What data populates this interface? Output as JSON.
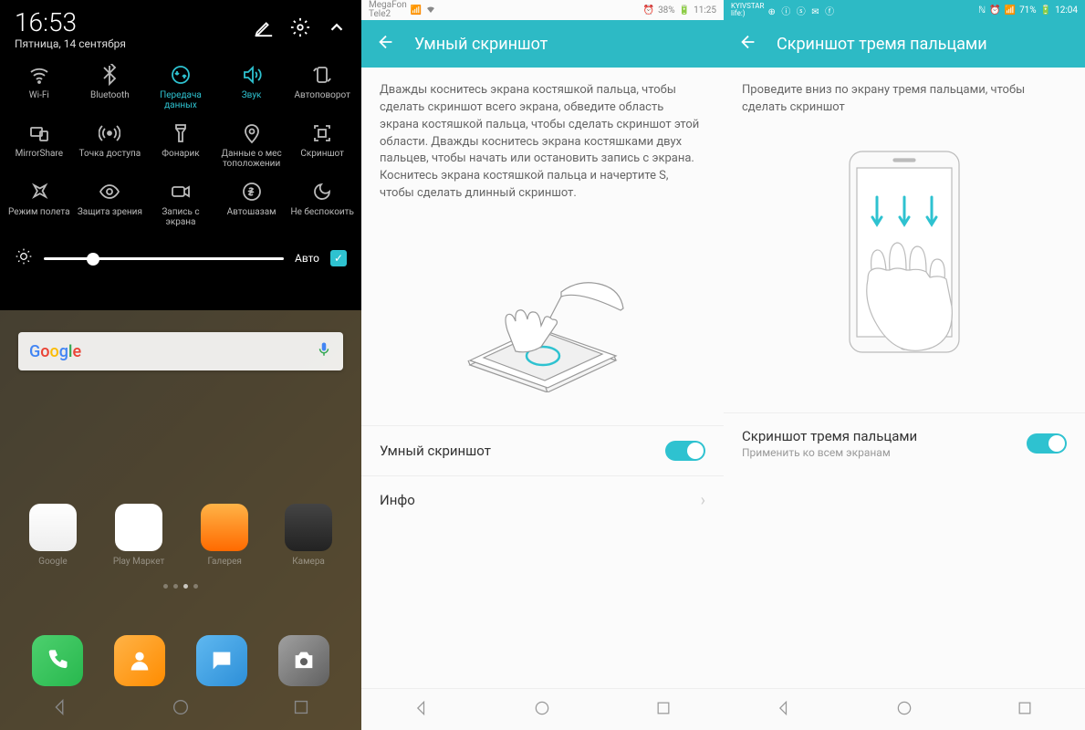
{
  "screen1": {
    "time": "16:53",
    "date": "Пятница, 14 сентября",
    "tiles": [
      {
        "label": "Wi-Fi",
        "icon": "wifi",
        "active": false
      },
      {
        "label": "Bluetooth",
        "icon": "bluetooth",
        "active": false
      },
      {
        "label": "Передача данных",
        "icon": "data",
        "active": true
      },
      {
        "label": "Звук",
        "icon": "sound",
        "active": true
      },
      {
        "label": "Автоповорот",
        "icon": "rotate",
        "active": false
      },
      {
        "label": "MirrorShare",
        "icon": "mirror",
        "active": false
      },
      {
        "label": "Точка доступа",
        "icon": "hotspot",
        "active": false
      },
      {
        "label": "Фонарик",
        "icon": "flashlight",
        "active": false
      },
      {
        "label": "Данные о мес тоположении",
        "icon": "location",
        "active": false
      },
      {
        "label": "Скриншот",
        "icon": "screenshot",
        "active": false
      },
      {
        "label": "Режим полета",
        "icon": "airplane",
        "active": false
      },
      {
        "label": "Защита зрения",
        "icon": "eye",
        "active": false
      },
      {
        "label": "Запись с экрана",
        "icon": "record",
        "active": false
      },
      {
        "label": "Автошазам",
        "icon": "shazam",
        "active": false
      },
      {
        "label": "Не беспокоить",
        "icon": "dnd",
        "active": false
      }
    ],
    "brightness_auto": "Авто",
    "home_apps": [
      "Google",
      "Play Маркет",
      "Галерея",
      "Камера"
    ]
  },
  "screen2": {
    "carrier1": "MegaFon",
    "carrier2": "Tele2",
    "battery": "38%",
    "time": "11:25",
    "title": "Умный скриншот",
    "description": "Дважды коснитесь экрана костяшкой пальца, чтобы сделать скриншот всего экрана, обведите область экрана костяшкой пальца, чтобы сделать скриншот этой области. Дважды коснитесь экрана костяшками двух пальцев, чтобы начать или остановить запись с экрана. Коснитесь экрана костяшкой пальца и начертите S, чтобы сделать длинный скриншот.",
    "setting1": "Умный скриншот",
    "setting2": "Инфо"
  },
  "screen3": {
    "carrier1": "KYIVSTAR",
    "carrier2": "life:)",
    "battery": "71%",
    "time": "12:04",
    "title": "Скриншот тремя пальцами",
    "description": "Проведите вниз по экрану тремя пальцами, чтобы сделать скриншот",
    "setting_label": "Скриншот тремя пальцами",
    "setting_sub": "Применить ко всем экранам"
  }
}
